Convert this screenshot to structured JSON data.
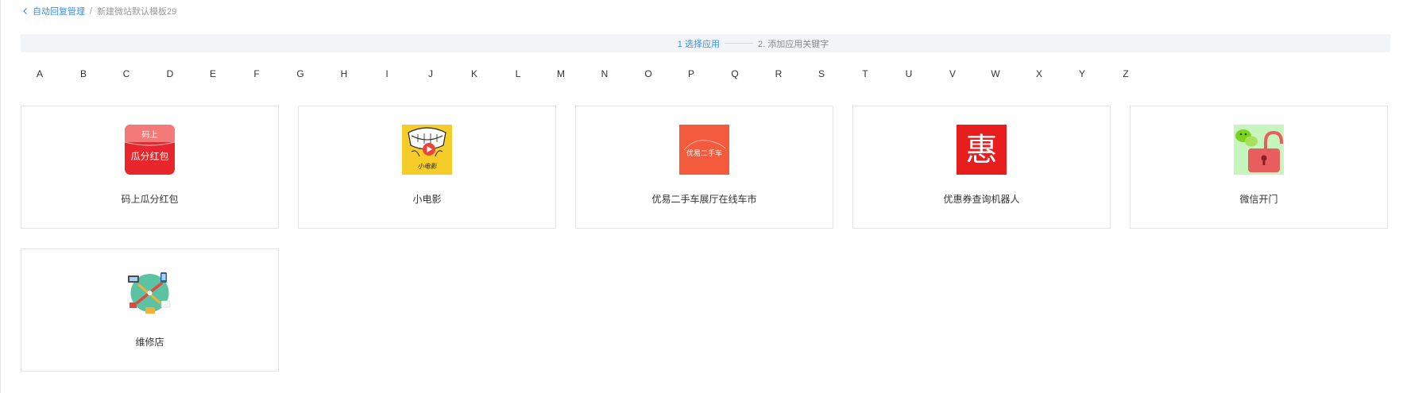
{
  "breadcrumb": {
    "parent": "自动回复管理",
    "separator": "/",
    "current": "新建微站默认模板29"
  },
  "steps": {
    "step1": "1 选择应用",
    "step2": "2. 添加应用关键字"
  },
  "alphabet": [
    "A",
    "B",
    "C",
    "D",
    "E",
    "F",
    "G",
    "H",
    "I",
    "J",
    "K",
    "L",
    "M",
    "N",
    "O",
    "P",
    "Q",
    "R",
    "S",
    "T",
    "U",
    "V",
    "W",
    "X",
    "Y",
    "Z"
  ],
  "apps": [
    {
      "name": "码上瓜分红包",
      "icon": "red-envelope-icon",
      "icon_text_top": "码上",
      "icon_text_bottom": "瓜分红包"
    },
    {
      "name": "小电影",
      "icon": "movie-icon",
      "icon_text": "小电影"
    },
    {
      "name": "优易二手车展厅在线车市",
      "icon": "car-market-icon",
      "icon_text": "优易二手车"
    },
    {
      "name": "优惠券查询机器人",
      "icon": "coupon-icon",
      "icon_text": "惠"
    },
    {
      "name": "微信开门",
      "icon": "wechat-unlock-icon"
    },
    {
      "name": "维修店",
      "icon": "repair-shop-icon"
    }
  ],
  "colors": {
    "accent": "#3a8ee6",
    "step_bar_bg": "#f3f4f7",
    "card_border": "#e3e5ea"
  }
}
